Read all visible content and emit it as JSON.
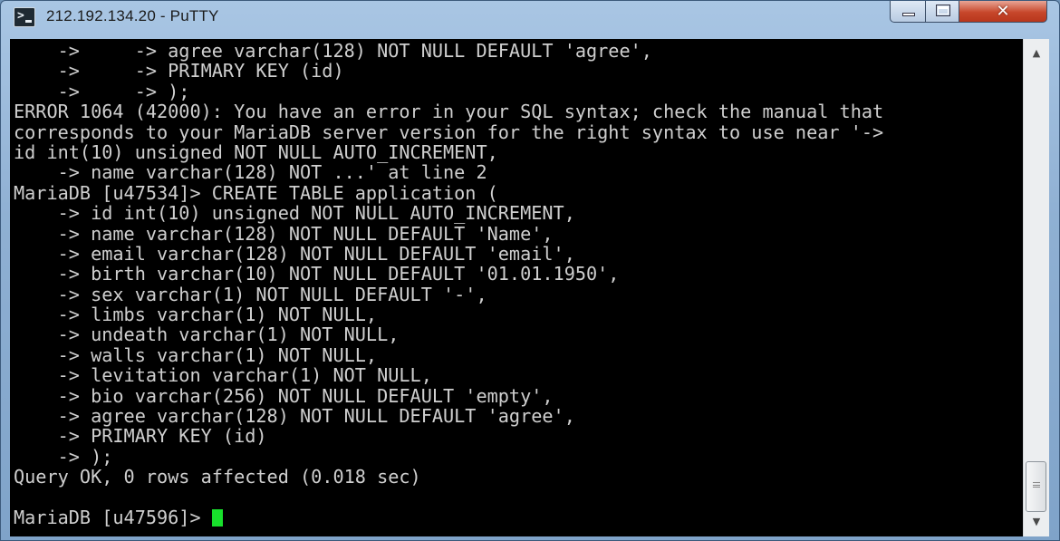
{
  "window": {
    "title": "212.192.134.20 - PuTTY",
    "icon": "putty-terminal-icon"
  },
  "controls": {
    "minimize_icon": "minimize-icon",
    "maximize_icon": "maximize-icon",
    "close_glyph": "✕"
  },
  "terminal": {
    "lines": [
      "    ->     -> agree varchar(128) NOT NULL DEFAULT 'agree',",
      "    ->     -> PRIMARY KEY (id)",
      "    ->     -> );",
      "ERROR 1064 (42000): You have an error in your SQL syntax; check the manual that",
      "corresponds to your MariaDB server version for the right syntax to use near '->",
      "id int(10) unsigned NOT NULL AUTO_INCREMENT,",
      "    -> name varchar(128) NOT ...' at line 2",
      "MariaDB [u47534]> CREATE TABLE application (",
      "    -> id int(10) unsigned NOT NULL AUTO_INCREMENT,",
      "    -> name varchar(128) NOT NULL DEFAULT 'Name',",
      "    -> email varchar(128) NOT NULL DEFAULT 'email',",
      "    -> birth varchar(10) NOT NULL DEFAULT '01.01.1950',",
      "    -> sex varchar(1) NOT NULL DEFAULT '-',",
      "    -> limbs varchar(1) NOT NULL,",
      "    -> undeath varchar(1) NOT NULL,",
      "    -> walls varchar(1) NOT NULL,",
      "    -> levitation varchar(1) NOT NULL,",
      "    -> bio varchar(256) NOT NULL DEFAULT 'empty',",
      "    -> agree varchar(128) NOT NULL DEFAULT 'agree',",
      "    -> PRIMARY KEY (id)",
      "    -> );",
      "Query OK, 0 rows affected (0.018 sec)"
    ],
    "prompt": "MariaDB [u47596]> ",
    "foreground_color": "#cfcfcf",
    "background_color": "#000000",
    "cursor_color": "#18e02c"
  },
  "scrollbar": {
    "up_arrow": "▲",
    "down_arrow": "▼"
  }
}
